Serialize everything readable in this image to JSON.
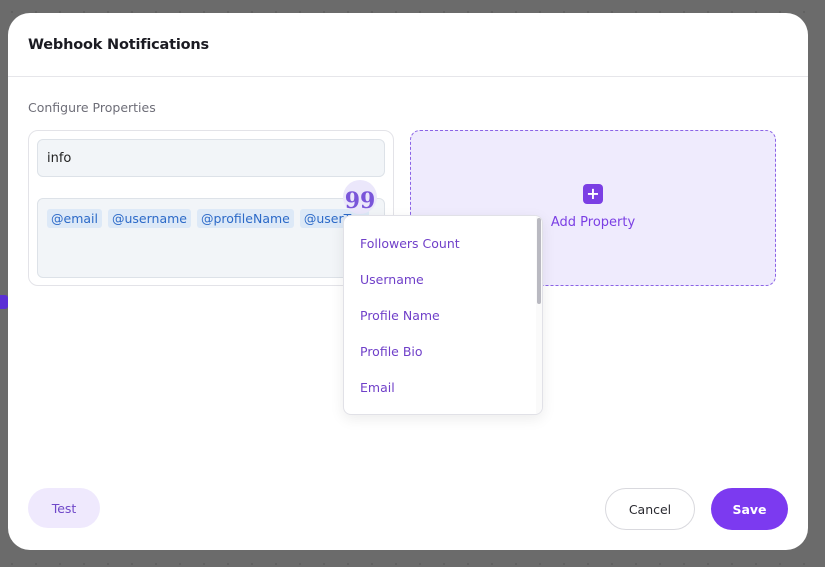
{
  "modal": {
    "title": "Webhook Notifications",
    "section_label": "Configure Properties"
  },
  "property": {
    "name_value": "info",
    "tags": [
      "@email",
      "@username",
      "@profileName",
      "@userTag"
    ]
  },
  "add_property": {
    "label": "Add Property",
    "icon": "plus-icon"
  },
  "quote_icon": "quote-icon",
  "dropdown": {
    "items": [
      "Followers Count",
      "Username",
      "Profile Name",
      "Profile Bio",
      "Email"
    ]
  },
  "actions": {
    "test_label": "Test",
    "cancel_label": "Cancel",
    "save_label": "Save"
  },
  "colors": {
    "accent": "#7c3af0",
    "accent_light": "#efebfd",
    "tag_text": "#2c6ac8"
  }
}
